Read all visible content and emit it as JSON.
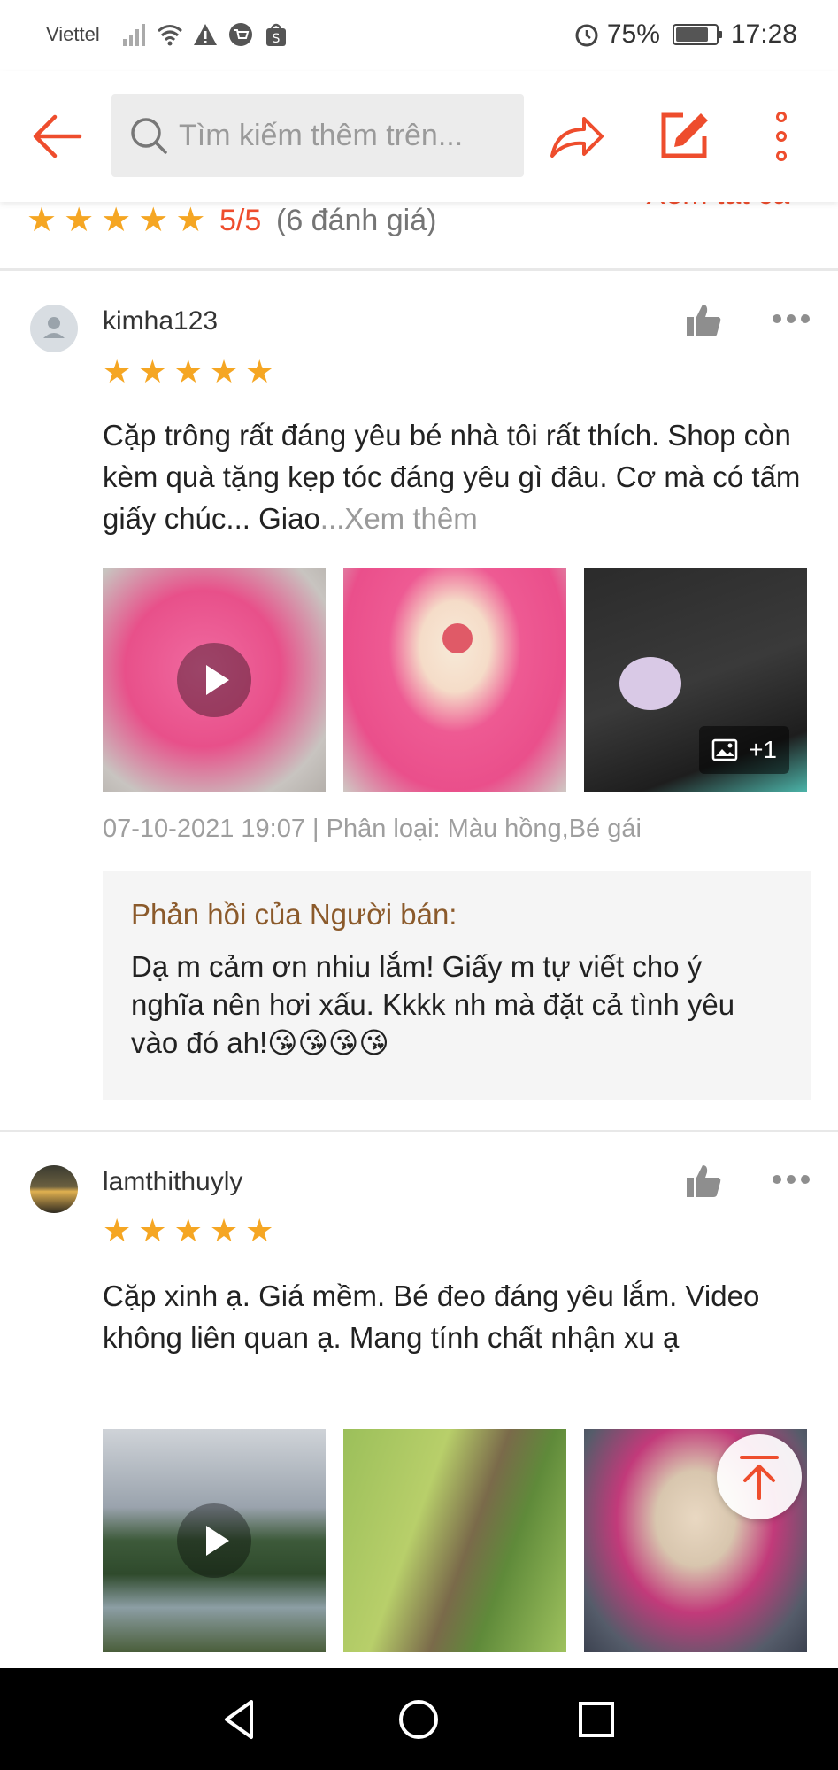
{
  "status_bar": {
    "carrier": "Viettel",
    "battery": "75%",
    "time": "17:28",
    "battery_level": 0.75,
    "icons": [
      "signal-icon",
      "wifi-icon",
      "warning-icon",
      "cart-notification-icon",
      "shopping-bag-icon",
      "alarm-icon",
      "battery-icon"
    ]
  },
  "header": {
    "search_placeholder": "Tìm kiếm thêm trên...",
    "accent_color": "#ee4d2d",
    "icons": [
      "back-arrow-icon",
      "search-icon",
      "share-icon",
      "edit-icon",
      "more-vert-icon"
    ]
  },
  "summary": {
    "rating": "5/5",
    "count_text": "(6 đánh giá)",
    "see_all": "Xem tất cả",
    "stars": 5
  },
  "reviews": [
    {
      "username": "kimha123",
      "stars": 5,
      "text": "Cặp trông rất đáng yêu bé nhà tôi rất thích. Shop còn kèm quà tặng kẹp tóc đáng yêu gì đâu. Cơ  mà có tấm giấy chúc... Giao",
      "more": "...Xem thêm",
      "extra_images": "+1",
      "meta": "07-10-2021 19:07 | Phân loại: Màu hồng,Bé gái",
      "seller_reply_title": "Phản hồi của Người bán:",
      "seller_reply_text": "Dạ m cảm ơn nhiu lắm! Giấy m tự viết cho ý nghĩa nên hơi xấu. Kkkk nh mà đặt cả tình yêu vào đó ah!😘😘😘😘"
    },
    {
      "username": "lamthithuyly",
      "stars": 5,
      "text": "Cặp xinh ạ. Giá mềm. Bé đeo đáng yêu lắm. Video không liên quan ạ. Mang tính chất nhận xu ạ"
    }
  ],
  "navigation_bar": {
    "icons": [
      "back-triangle-icon",
      "home-circle-icon",
      "recents-square-icon"
    ]
  }
}
